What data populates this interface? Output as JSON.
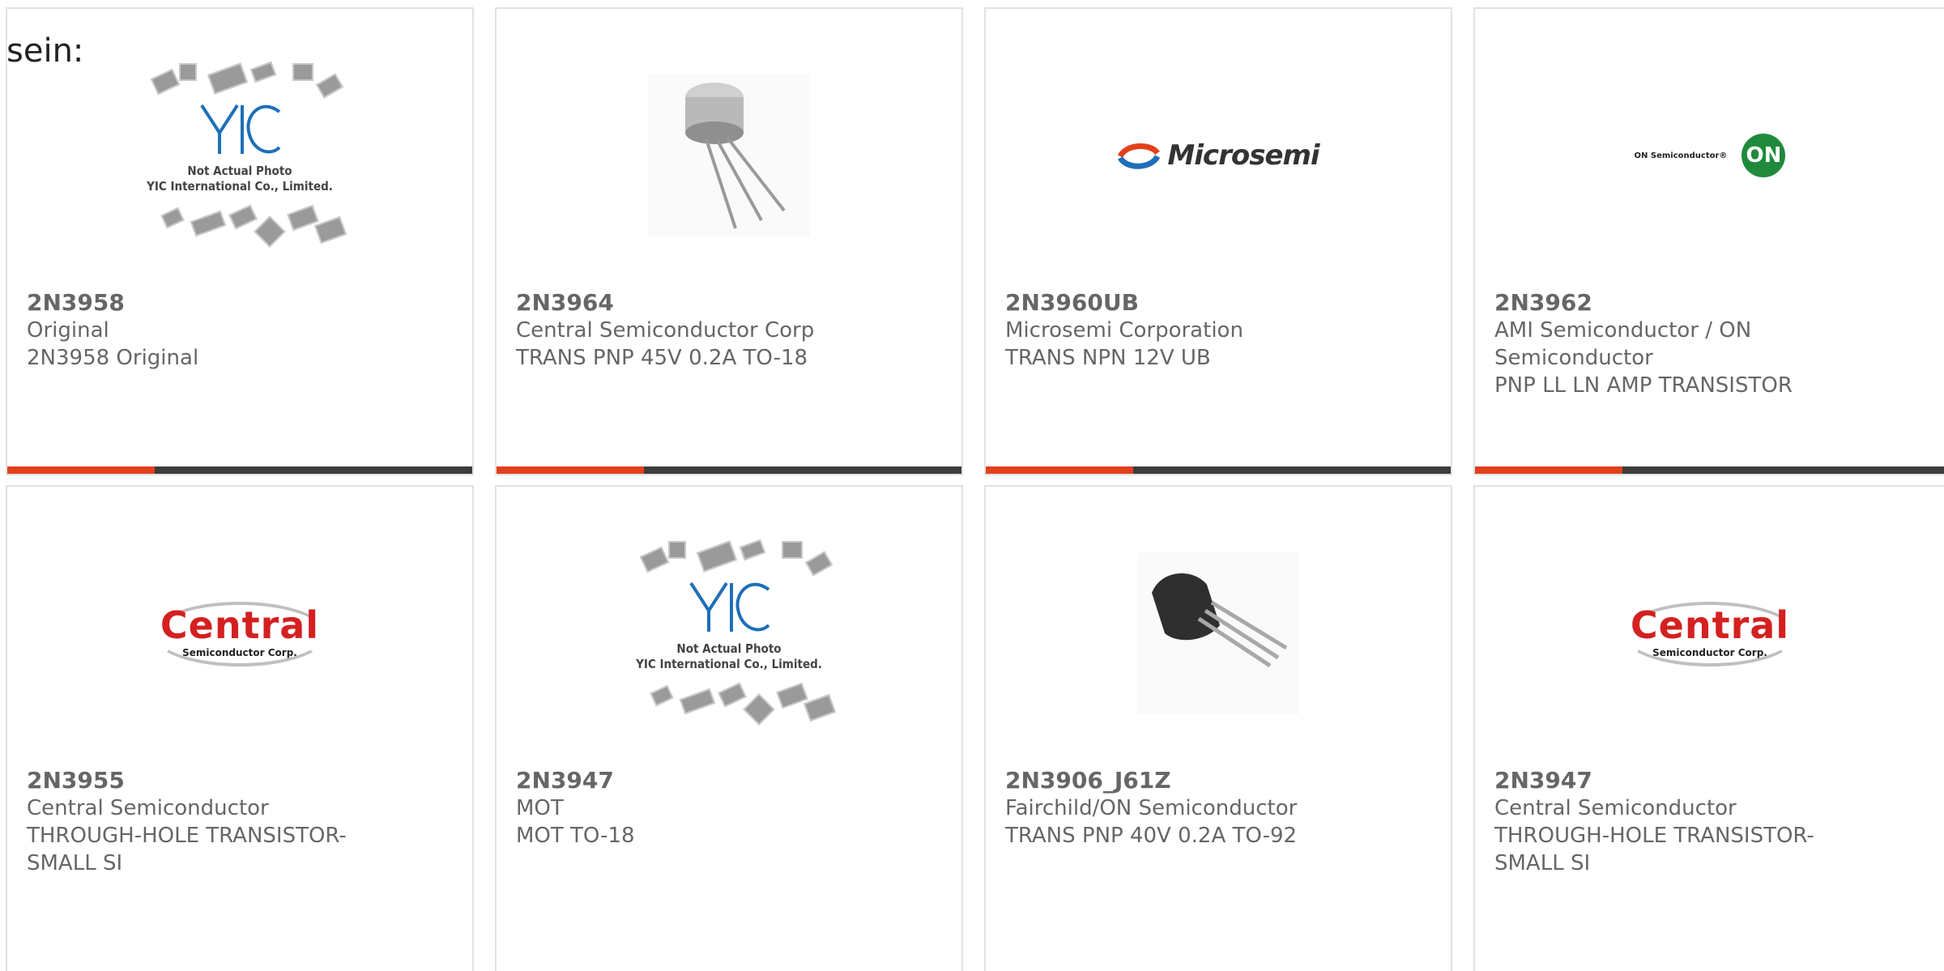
{
  "page": {
    "prefix_text": "sein:"
  },
  "products": [
    {
      "part": "2N3958",
      "lines": [
        "Original",
        "2N3958 Original"
      ],
      "image": "yic-placeholder"
    },
    {
      "part": "2N3964",
      "lines": [
        "Central Semiconductor Corp",
        "TRANS PNP 45V 0.2A TO-18"
      ],
      "image": "to18-transistor-photo"
    },
    {
      "part": "2N3960UB",
      "lines": [
        "Microsemi Corporation",
        "TRANS NPN 12V UB"
      ],
      "image": "microsemi-logo"
    },
    {
      "part": "2N3962",
      "lines": [
        "AMI Semiconductor / ON",
        "Semiconductor",
        "PNP LL LN AMP TRANSISTOR"
      ],
      "image": "on-semiconductor-logo"
    },
    {
      "part": "2N3955",
      "lines": [
        "Central Semiconductor",
        "THROUGH-HOLE TRANSISTOR-",
        "SMALL SI"
      ],
      "image": "central-logo"
    },
    {
      "part": "2N3947",
      "lines": [
        "MOT",
        "MOT TO-18"
      ],
      "image": "yic-placeholder"
    },
    {
      "part": "2N3906_J61Z",
      "lines": [
        "Fairchild/ON Semiconductor",
        "TRANS PNP 40V 0.2A TO-92"
      ],
      "image": "to92-transistor-photo"
    },
    {
      "part": "2N3947",
      "lines": [
        "Central Semiconductor",
        "THROUGH-HOLE TRANSISTOR-",
        "SMALL SI"
      ],
      "image": "central-logo"
    }
  ],
  "logos": {
    "yic_brand": "YIC",
    "yic_caption_1": "Not Actual Photo",
    "yic_caption_2": "YIC International Co., Limited.",
    "microsemi": "Microsemi",
    "on_semi_text": "ON Semiconductor®",
    "on_semi_mark": "ON",
    "central_word": "Central",
    "central_sub": "Semiconductor Corp."
  },
  "colors": {
    "accent": "#e2401b",
    "bar_dark": "#3c3c3c",
    "card_border": "#e2e2e2",
    "text": "#666666"
  }
}
